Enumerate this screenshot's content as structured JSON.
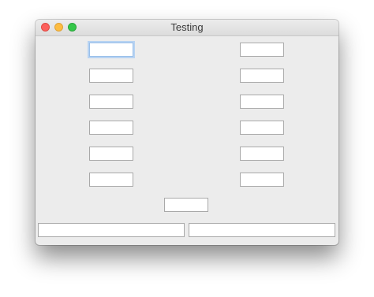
{
  "window": {
    "title": "Testing"
  },
  "left_fields": [
    {
      "value": ""
    },
    {
      "value": ""
    },
    {
      "value": ""
    },
    {
      "value": ""
    },
    {
      "value": ""
    },
    {
      "value": ""
    }
  ],
  "right_fields": [
    {
      "value": ""
    },
    {
      "value": ""
    },
    {
      "value": ""
    },
    {
      "value": ""
    },
    {
      "value": ""
    },
    {
      "value": ""
    }
  ],
  "center_field": {
    "value": ""
  },
  "bottom_fields": [
    {
      "value": ""
    },
    {
      "value": ""
    }
  ]
}
